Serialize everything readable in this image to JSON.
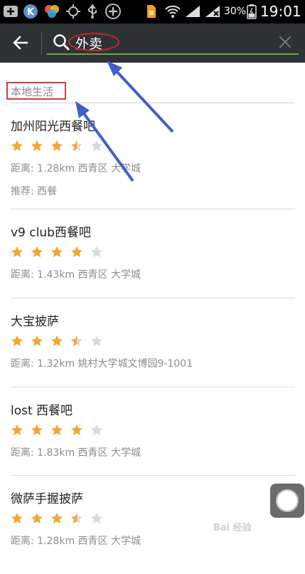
{
  "status": {
    "battery": "30%",
    "time": "19:01"
  },
  "search": {
    "value": "外卖"
  },
  "section_title": "本地生活",
  "results": [
    {
      "name": "加州阳光西餐吧",
      "rating": 3.5,
      "distance": "距离: 1.28km 西青区 大学城",
      "recommend": "推荐: 西餐"
    },
    {
      "name": "v9 club西餐吧",
      "rating": 4,
      "distance": "距离: 1.43km 西青区 大学城"
    },
    {
      "name": "大宝披萨",
      "rating": 3.5,
      "distance": "距离: 1.32km 姚村大学城文博园9-1001"
    },
    {
      "name": "lost 西餐吧",
      "rating": 4,
      "distance": "距离: 1.83km 西青区 大学城"
    },
    {
      "name": "微萨手握披萨",
      "rating": 3.5,
      "distance": "距离: 1.28km 西青区 大学城"
    }
  ],
  "colors": {
    "star": "#f4a630",
    "star_empty": "#d9d9d9",
    "annotation_red": "#d33b3b",
    "arrow_blue": "#3f5fc9"
  },
  "watermark": "Bai 经验"
}
